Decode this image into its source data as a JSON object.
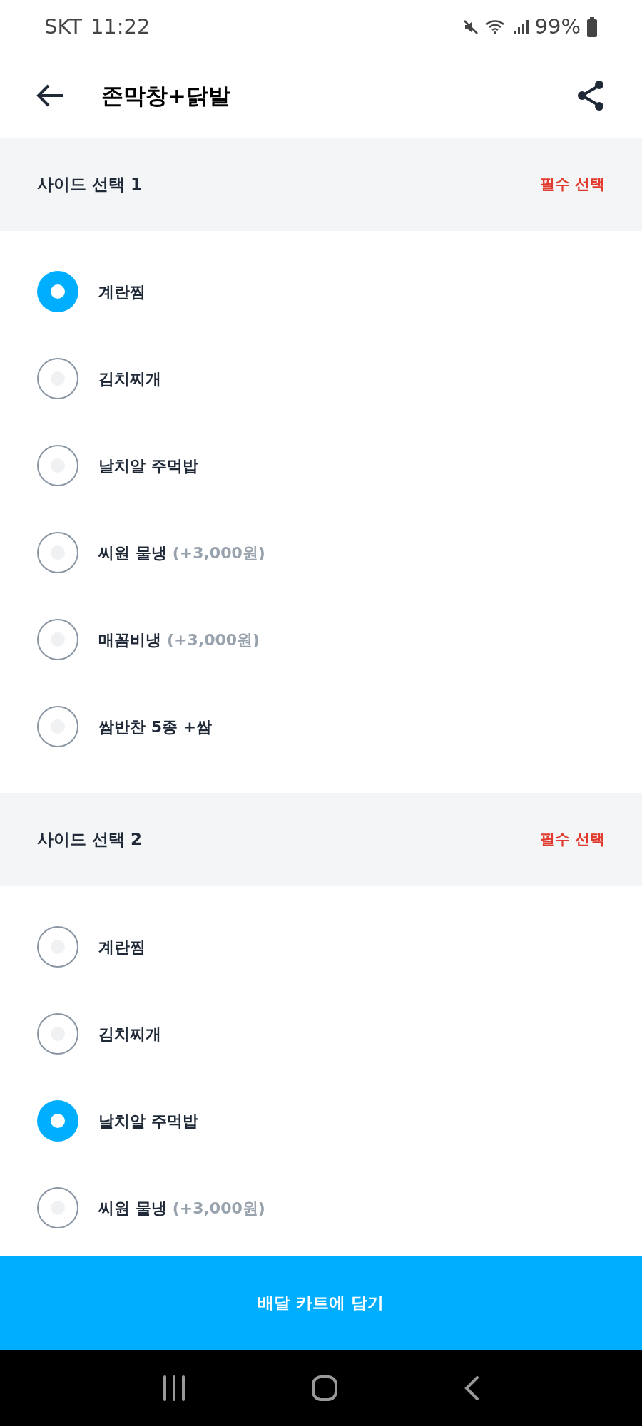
{
  "status_bar": {
    "carrier": "SKT",
    "time": "11:22",
    "battery": "99%"
  },
  "header": {
    "title": "존막창+닭발"
  },
  "sections": [
    {
      "title": "사이드 선택 1",
      "badge": "필수 선택",
      "options": [
        {
          "label": "계란찜",
          "selected": true
        },
        {
          "label": "김치찌개",
          "selected": false
        },
        {
          "label": "날치알 주먹밥",
          "selected": false
        },
        {
          "label": "씨원 물냉",
          "price": "(+3,000원)",
          "selected": false
        },
        {
          "label": "매꼼비냉",
          "price": "(+3,000원)",
          "selected": false
        },
        {
          "label": "쌈반찬 5종 +쌈",
          "selected": false
        }
      ]
    },
    {
      "title": "사이드 선택 2",
      "badge": "필수 선택",
      "options": [
        {
          "label": "계란찜",
          "selected": false
        },
        {
          "label": "김치찌개",
          "selected": false
        },
        {
          "label": "날치알 주먹밥",
          "selected": true
        },
        {
          "label": "씨원 물냉",
          "price": "(+3,000원)",
          "selected": false
        }
      ]
    }
  ],
  "cart_button": "배달 카트에 담기"
}
